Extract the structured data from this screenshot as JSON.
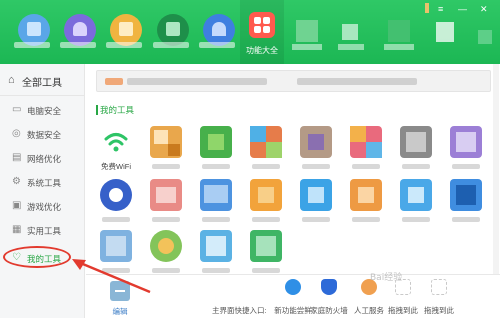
{
  "header": {
    "nav_items": [
      {
        "icon": "monitor-icon",
        "color": "#5aa6e8"
      },
      {
        "icon": "shield-icon",
        "color": "#7b6bdc"
      },
      {
        "icon": "broom-icon",
        "color": "#f0b440"
      },
      {
        "icon": "box-icon",
        "color": "#1e8f4a"
      },
      {
        "icon": "rocket-icon",
        "color": "#3f7fe0"
      }
    ],
    "function_center_label": "功能大全",
    "accent": "#1fba57"
  },
  "sidebar": {
    "header_label": "全部工具",
    "items": [
      {
        "label": "电脑安全",
        "icon": "monitor-icon"
      },
      {
        "label": "数据安全",
        "icon": "shield-icon"
      },
      {
        "label": "网络优化",
        "icon": "wifi-icon"
      },
      {
        "label": "系统工具",
        "icon": "gear-icon"
      },
      {
        "label": "游戏优化",
        "icon": "gamepad-icon"
      },
      {
        "label": "实用工具",
        "icon": "toolbox-icon"
      },
      {
        "label": "我的工具",
        "icon": "heart-icon",
        "active": true
      }
    ]
  },
  "main": {
    "section_title": "我的工具",
    "tools": [
      {
        "label": "免费WiFi",
        "color": "#2ec466",
        "icon": "wifi-icon"
      },
      {
        "label": "",
        "color": "#e9a74c"
      },
      {
        "label": "",
        "color": "#47b04b"
      },
      {
        "label": "",
        "color": "#e67c4a"
      },
      {
        "label": "",
        "color": "#b49a86"
      },
      {
        "label": "",
        "color": "#e96a7d"
      },
      {
        "label": "",
        "color": "#8a8a8a"
      },
      {
        "label": "",
        "color": "#9c7fd6"
      },
      {
        "label": "",
        "color": "#3660c9"
      },
      {
        "label": "",
        "color": "#e98b86"
      },
      {
        "label": "",
        "color": "#4d93e0"
      },
      {
        "label": "",
        "color": "#f2a33b"
      },
      {
        "label": "",
        "color": "#3ba3e6"
      },
      {
        "label": "",
        "color": "#ee9a43"
      },
      {
        "label": "",
        "color": "#4aa8e8"
      },
      {
        "label": "",
        "color": "#3f8de0"
      },
      {
        "label": "",
        "color": "#7fb2e0"
      },
      {
        "label": "",
        "color": "#83c45a"
      },
      {
        "label": "",
        "color": "#5bb2e4"
      },
      {
        "label": "",
        "color": "#3fb565"
      }
    ]
  },
  "footer": {
    "edit_label": "编辑",
    "quick_entry_label": "主界面快捷入口:",
    "quick_items": [
      {
        "label": "新功能尝鲜",
        "color": "#2f8fe6"
      },
      {
        "label": "家庭防火墙",
        "color": "#2d6ad8"
      },
      {
        "label": "人工服务",
        "color": "#f0a050"
      },
      {
        "label": "拖拽到此",
        "color": "#c9c9c9"
      },
      {
        "label": "拖拽到此",
        "color": "#c9c9c9"
      }
    ]
  },
  "watermark": "Bai经验"
}
